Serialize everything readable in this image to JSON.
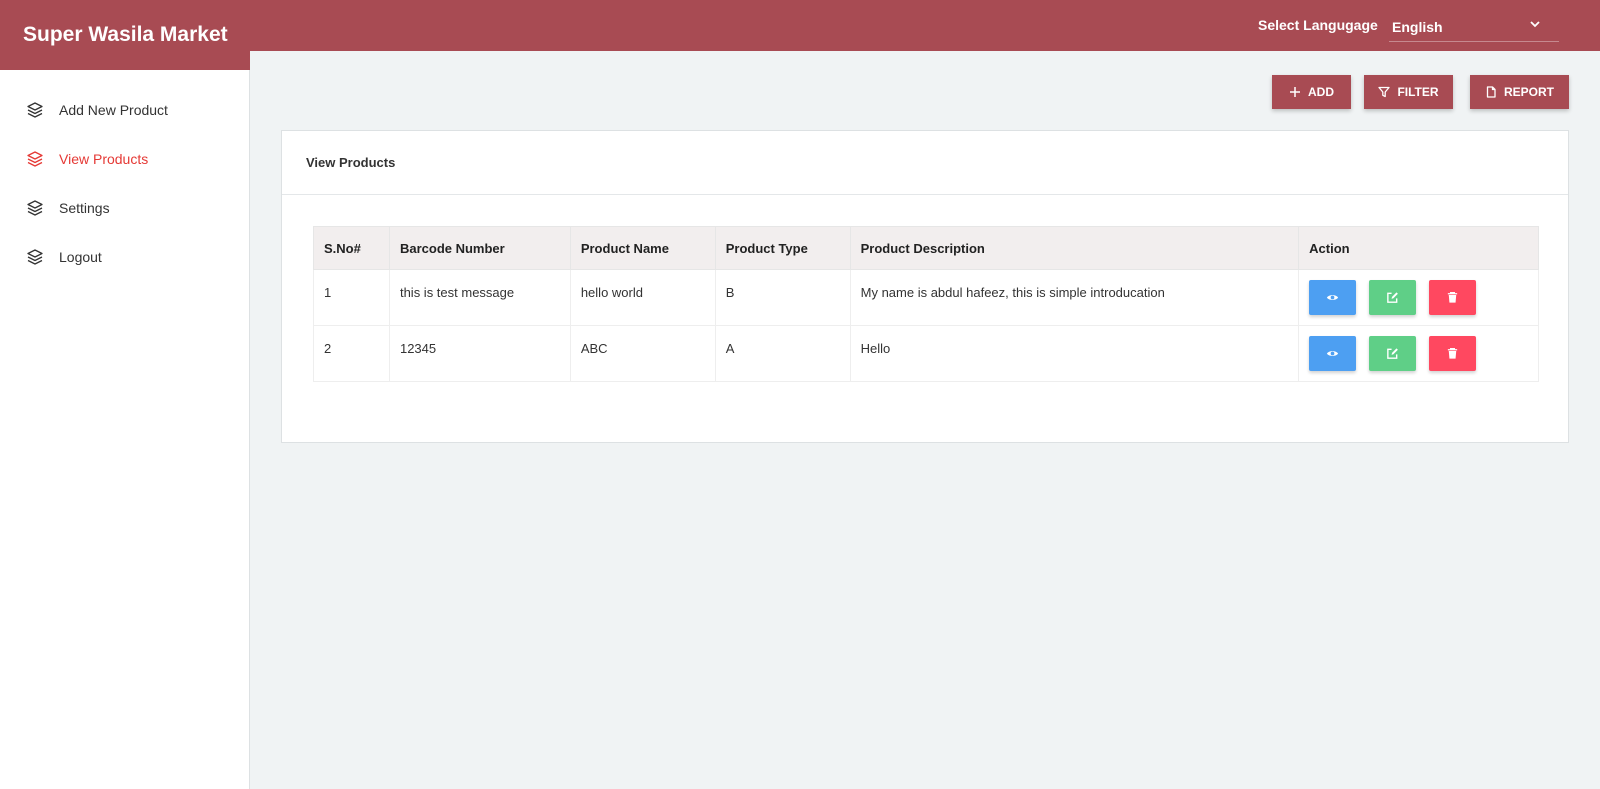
{
  "app": {
    "title": "Super Wasila Market"
  },
  "header": {
    "language_label": "Select Langugage",
    "language_value": "English"
  },
  "sidebar": {
    "items": [
      {
        "label": "Add New Product",
        "icon": "layers-icon"
      },
      {
        "label": "View Products",
        "icon": "layers-icon",
        "active": true
      },
      {
        "label": "Settings",
        "icon": "layers-icon"
      },
      {
        "label": "Logout",
        "icon": "layers-icon"
      }
    ]
  },
  "toolbar": {
    "add_label": "ADD",
    "filter_label": "FILTER",
    "report_label": "REPORT"
  },
  "card": {
    "title": "View Products"
  },
  "table": {
    "headers": [
      "S.No#",
      "Barcode Number",
      "Product Name",
      "Product Type",
      "Product Description",
      "Action"
    ],
    "rows": [
      {
        "sno": "1",
        "barcode": "this is test message",
        "name": "hello world",
        "type": "B",
        "description": "My name is abdul hafeez, this is simple introducation"
      },
      {
        "sno": "2",
        "barcode": "12345",
        "name": "ABC",
        "type": "A",
        "description": "Hello"
      }
    ]
  },
  "colors": {
    "brand": "#a84b53",
    "active_nav": "#e53935",
    "view_button": "#4d9ff2",
    "edit_button": "#5fcf87",
    "delete_button": "#ff4860",
    "background": "#f0f3f4"
  }
}
